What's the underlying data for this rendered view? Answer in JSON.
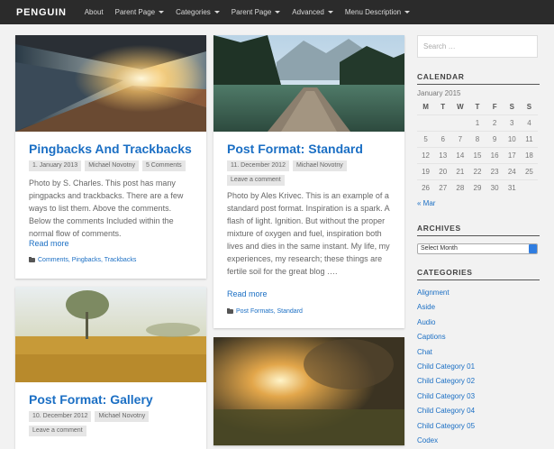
{
  "header": {
    "brand": "PENGUIN",
    "nav": [
      {
        "label": "About",
        "dropdown": false
      },
      {
        "label": "Parent Page",
        "dropdown": true
      },
      {
        "label": "Categories",
        "dropdown": true
      },
      {
        "label": "Parent Page",
        "dropdown": true
      },
      {
        "label": "Advanced",
        "dropdown": true
      },
      {
        "label": "Menu Description",
        "dropdown": true
      }
    ]
  },
  "posts": [
    {
      "title": "Pingbacks And Trackbacks",
      "meta": [
        "1. January 2013",
        "Michael Novotny",
        "5 Comments"
      ],
      "excerpt": "Photo by S. Charles. This post has many pingpacks and trackbacks. There are a few ways to list them. Above the comments. Below the comments Included within the normal flow of comments.",
      "more": "Read more",
      "categories": "Comments, Pingbacks, Trackbacks"
    },
    {
      "title": "Post Format: Standard",
      "meta": [
        "11. December 2012",
        "Michael Novotny",
        "Leave a comment"
      ],
      "excerpt": "Photo by Ales Krivec. This is an example of a standard post format. Inspiration is a spark. A flash of light. Ignition. But without the proper mixture of oxygen and fuel, inspiration both lives and dies in the same instant. My life, my experiences, my research; these things are fertile soil for the great blog ….",
      "more": "Read more",
      "categories": "Post Formats, Standard"
    },
    {
      "title": "Post Format: Gallery",
      "meta": [
        "10. December 2012",
        "Michael Novotny",
        "Leave a comment"
      ]
    },
    {
      "title": ""
    }
  ],
  "sidebar": {
    "search_placeholder": "Search …",
    "calendar": {
      "title": "CALENDAR",
      "caption": "January 2015",
      "days": [
        "M",
        "T",
        "W",
        "T",
        "F",
        "S",
        "S"
      ],
      "weeks": [
        [
          "",
          "",
          "",
          "1",
          "2",
          "3",
          "4"
        ],
        [
          "5",
          "6",
          "7",
          "8",
          "9",
          "10",
          "11"
        ],
        [
          "12",
          "13",
          "14",
          "15",
          "16",
          "17",
          "18"
        ],
        [
          "19",
          "20",
          "21",
          "22",
          "23",
          "24",
          "25"
        ],
        [
          "26",
          "27",
          "28",
          "29",
          "30",
          "31",
          ""
        ]
      ],
      "prev": "« Mar"
    },
    "archives": {
      "title": "ARCHIVES",
      "selected": "Select Month"
    },
    "categories": {
      "title": "CATEGORIES",
      "items": [
        "Alignment",
        "Aside",
        "Audio",
        "Captions",
        "Chat",
        "Child Category 01",
        "Child Category 02",
        "Child Category 03",
        "Child Category 04",
        "Child Category 05",
        "Codex"
      ]
    }
  },
  "colors": {
    "link": "#1b6fc4",
    "topbar": "#2b2b2b",
    "background": "#f2f2f2"
  }
}
